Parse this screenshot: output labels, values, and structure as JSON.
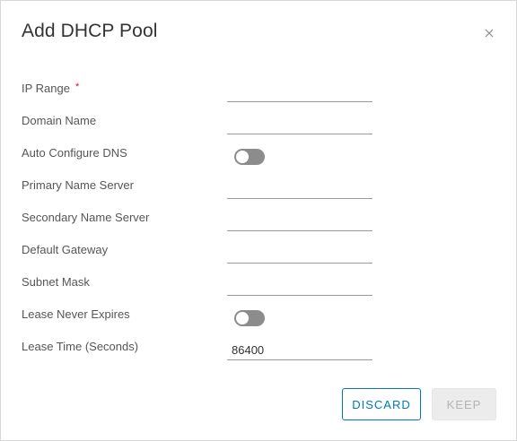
{
  "dialog": {
    "title": "Add DHCP Pool",
    "close_icon": "close-icon"
  },
  "form": {
    "ip_range": {
      "label": "IP Range",
      "required_mark": "*",
      "value": ""
    },
    "domain_name": {
      "label": "Domain Name",
      "value": ""
    },
    "auto_configure_dns": {
      "label": "Auto Configure DNS",
      "enabled": false
    },
    "primary_name_server": {
      "label": "Primary Name Server",
      "value": ""
    },
    "secondary_name_server": {
      "label": "Secondary Name Server",
      "value": ""
    },
    "default_gateway": {
      "label": "Default Gateway",
      "value": ""
    },
    "subnet_mask": {
      "label": "Subnet Mask",
      "value": ""
    },
    "lease_never_expires": {
      "label": "Lease Never Expires",
      "enabled": false
    },
    "lease_time": {
      "label": "Lease Time (Seconds)",
      "value": "86400"
    }
  },
  "footer": {
    "discard_label": "DISCARD",
    "keep_label": "KEEP",
    "keep_disabled": true
  },
  "colors": {
    "accent": "#0079b8",
    "required": "#c92100",
    "toggle_off": "#8c8c8c",
    "disabled_button_bg": "#ececec"
  }
}
